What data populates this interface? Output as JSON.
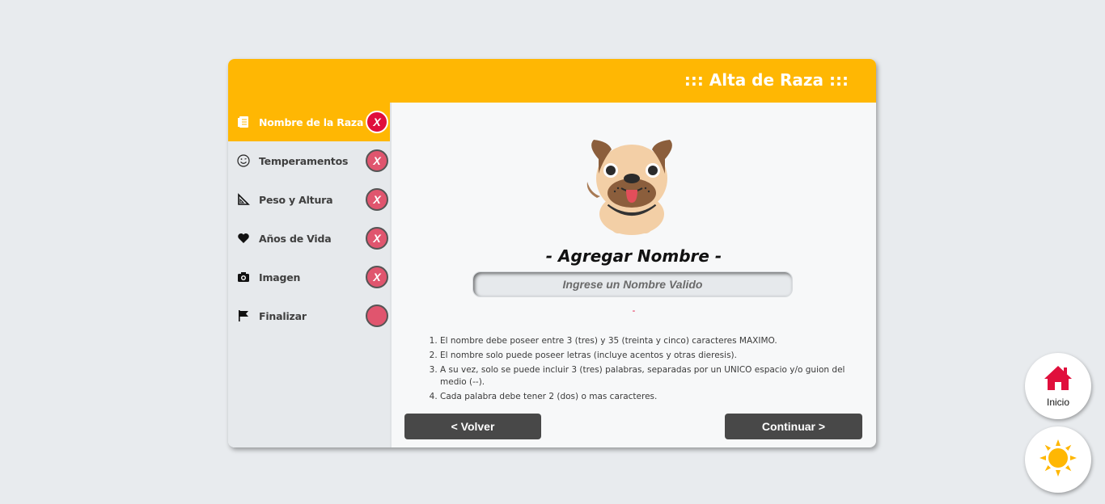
{
  "card": {
    "title": "::: Alta de Raza :::"
  },
  "sidebar": {
    "steps": [
      {
        "label": "Nombre de la Raza",
        "icon": "book-icon",
        "status": "X",
        "active": true
      },
      {
        "label": "Temperamentos",
        "icon": "smiley-icon",
        "status": "X",
        "active": false
      },
      {
        "label": "Peso y Altura",
        "icon": "set-square-icon",
        "status": "X",
        "active": false
      },
      {
        "label": "Años de Vida",
        "icon": "heart-icon",
        "status": "X",
        "active": false
      },
      {
        "label": "Imagen",
        "icon": "camera-icon",
        "status": "X",
        "active": false
      },
      {
        "label": "Finalizar",
        "icon": "flag-icon",
        "status": "",
        "active": false
      }
    ]
  },
  "main": {
    "title": "- Agregar Nombre -",
    "input": {
      "placeholder": "Ingrese un Nombre Valido",
      "value": ""
    },
    "error": "-",
    "rules": [
      "El nombre debe poseer entre 3 (tres) y 35 (treinta y cinco) caracteres MAXIMO.",
      "El nombre solo puede poseer letras (incluye acentos y otras dieresis).",
      "A su vez, solo se puede incluir 3 (tres) palabras, separadas por un UNICO espacio y/o guion del medio (--).",
      "Cada palabra debe tener 2 (dos) o mas caracteres."
    ],
    "back_label": "< Volver",
    "next_label": "Continuar >"
  },
  "fabs": {
    "home_label": "Inicio"
  },
  "colors": {
    "accent": "#ffb703",
    "error": "#e00f3c",
    "button": "#484848"
  }
}
